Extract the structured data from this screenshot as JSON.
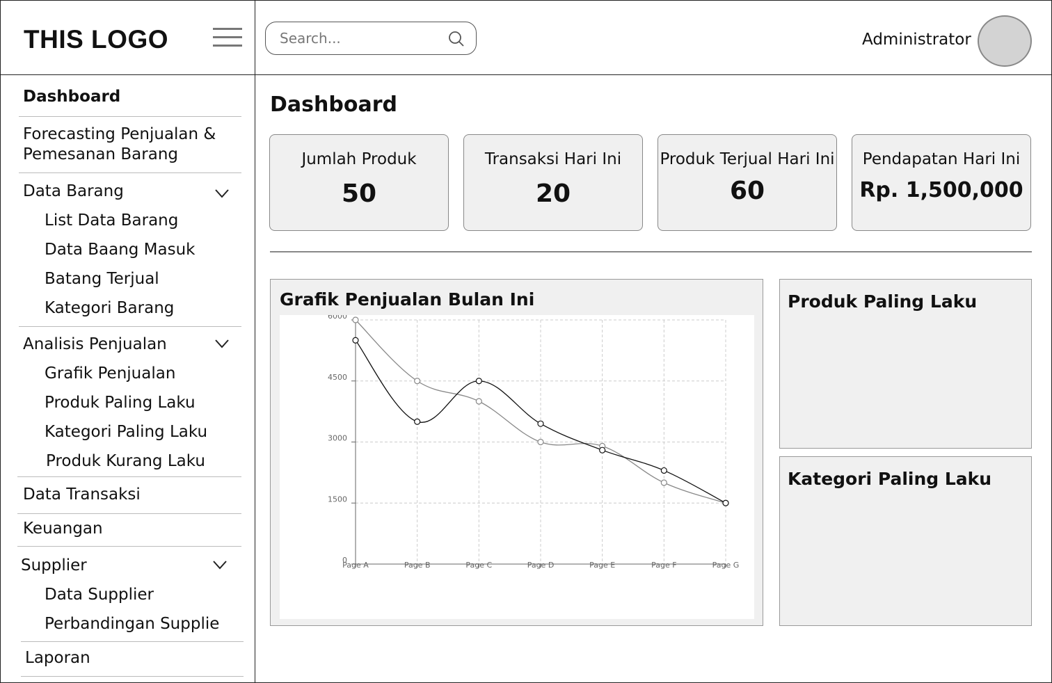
{
  "logo": {
    "text": "THIS LOGO"
  },
  "search": {
    "placeholder": "Search..."
  },
  "user": {
    "name": "Administrator"
  },
  "sidebar": {
    "dashboard": "Dashboard",
    "forecasting_line1": "Forecasting Penjualan &",
    "forecasting_line2": "Pemesanan Barang",
    "data_barang": {
      "label": "Data Barang",
      "items": [
        "List Data Barang",
        "Data Baang Masuk",
        "Batang Terjual",
        "Kategori Barang"
      ]
    },
    "analisis_penjualan": {
      "label": "Analisis Penjualan",
      "items": [
        "Grafik Penjualan",
        "Produk Paling Laku",
        "Kategori Paling Laku",
        "Produk Kurang Laku"
      ]
    },
    "data_transaksi": "Data Transaksi",
    "keuangan": "Keuangan",
    "supplier": {
      "label": "Supplier",
      "items": [
        "Data Supplier",
        "Perbandingan Supplie"
      ]
    },
    "laporan": "Laporan"
  },
  "main": {
    "title": "Dashboard",
    "cards": [
      {
        "label": "Jumlah Produk",
        "value": "50"
      },
      {
        "label": "Transaksi Hari Ini",
        "value": "20"
      },
      {
        "label": "Produk Terjual Hari Ini",
        "value": "60"
      },
      {
        "label": "Pendapatan Hari Ini",
        "value": "Rp. 1,500,000"
      }
    ],
    "chart_panel_title": "Grafik Penjualan Bulan Ini",
    "produk_panel_title": "Produk Paling Laku",
    "kategori_panel_title": "Kategori Paling Laku"
  },
  "colors": {
    "panel_bg": "#f0f0f0",
    "series_dark": "#111111",
    "series_light": "#888888",
    "grid": "#cccccc"
  },
  "icons": {
    "menu": "hamburger-menu-icon",
    "search": "search-icon",
    "expand": "chevron-down-icon"
  },
  "chart_data": {
    "type": "line",
    "categories": [
      "Page A",
      "Page B",
      "Page C",
      "Page D",
      "Page E",
      "Page F",
      "Page G"
    ],
    "series": [
      {
        "values": [
          5500,
          3500,
          4500,
          3450,
          2800,
          2300,
          1500
        ]
      },
      {
        "values": [
          6000,
          4500,
          4000,
          3000,
          2900,
          2000,
          1500
        ]
      }
    ],
    "ylim": [
      0,
      6000
    ],
    "yticks": [
      "0",
      "1500",
      "3000",
      "4500",
      "6000"
    ],
    "grid": true,
    "legend": "none"
  }
}
